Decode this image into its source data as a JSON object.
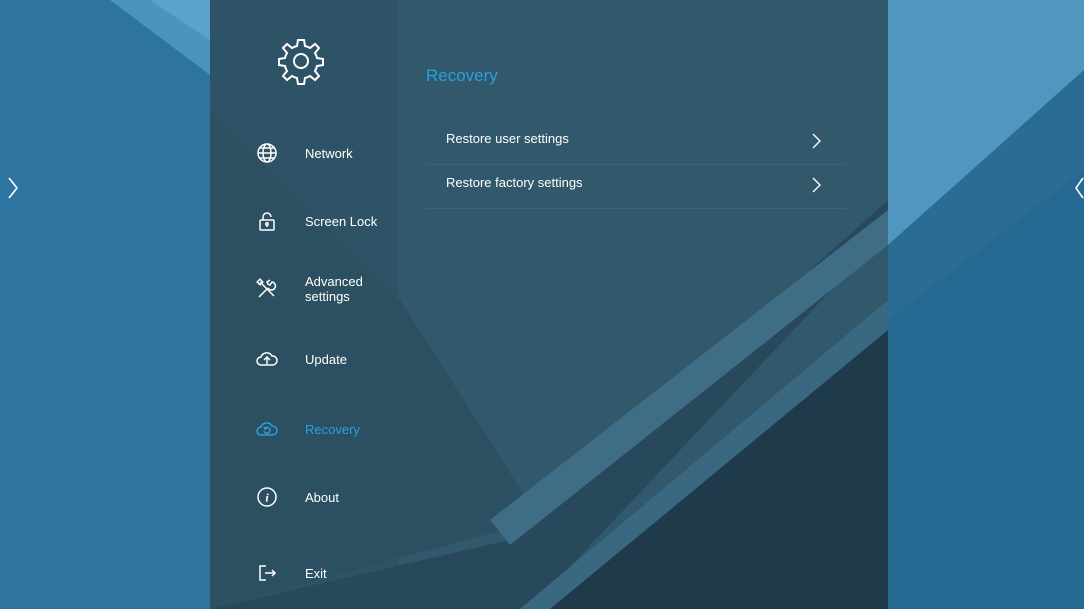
{
  "colors": {
    "accent": "#2aa0e0",
    "text": "#ffffff",
    "panel": "#2f5568"
  },
  "header": {
    "icon": "gear-icon"
  },
  "sidebar": {
    "items": [
      {
        "label": "Network",
        "icon": "globe-icon",
        "active": false
      },
      {
        "label": "Screen Lock",
        "icon": "lock-icon",
        "active": false
      },
      {
        "label": "Advanced settings",
        "icon": "tools-icon",
        "active": false
      },
      {
        "label": "Update",
        "icon": "cloud-upload-icon",
        "active": false
      },
      {
        "label": "Recovery",
        "icon": "cloud-restore-icon",
        "active": true
      },
      {
        "label": "About",
        "icon": "info-icon",
        "active": false
      },
      {
        "label": "Exit",
        "icon": "exit-icon",
        "active": false
      }
    ]
  },
  "main": {
    "title": "Recovery",
    "options": [
      {
        "label": "Restore user settings"
      },
      {
        "label": "Restore factory settings"
      }
    ]
  }
}
